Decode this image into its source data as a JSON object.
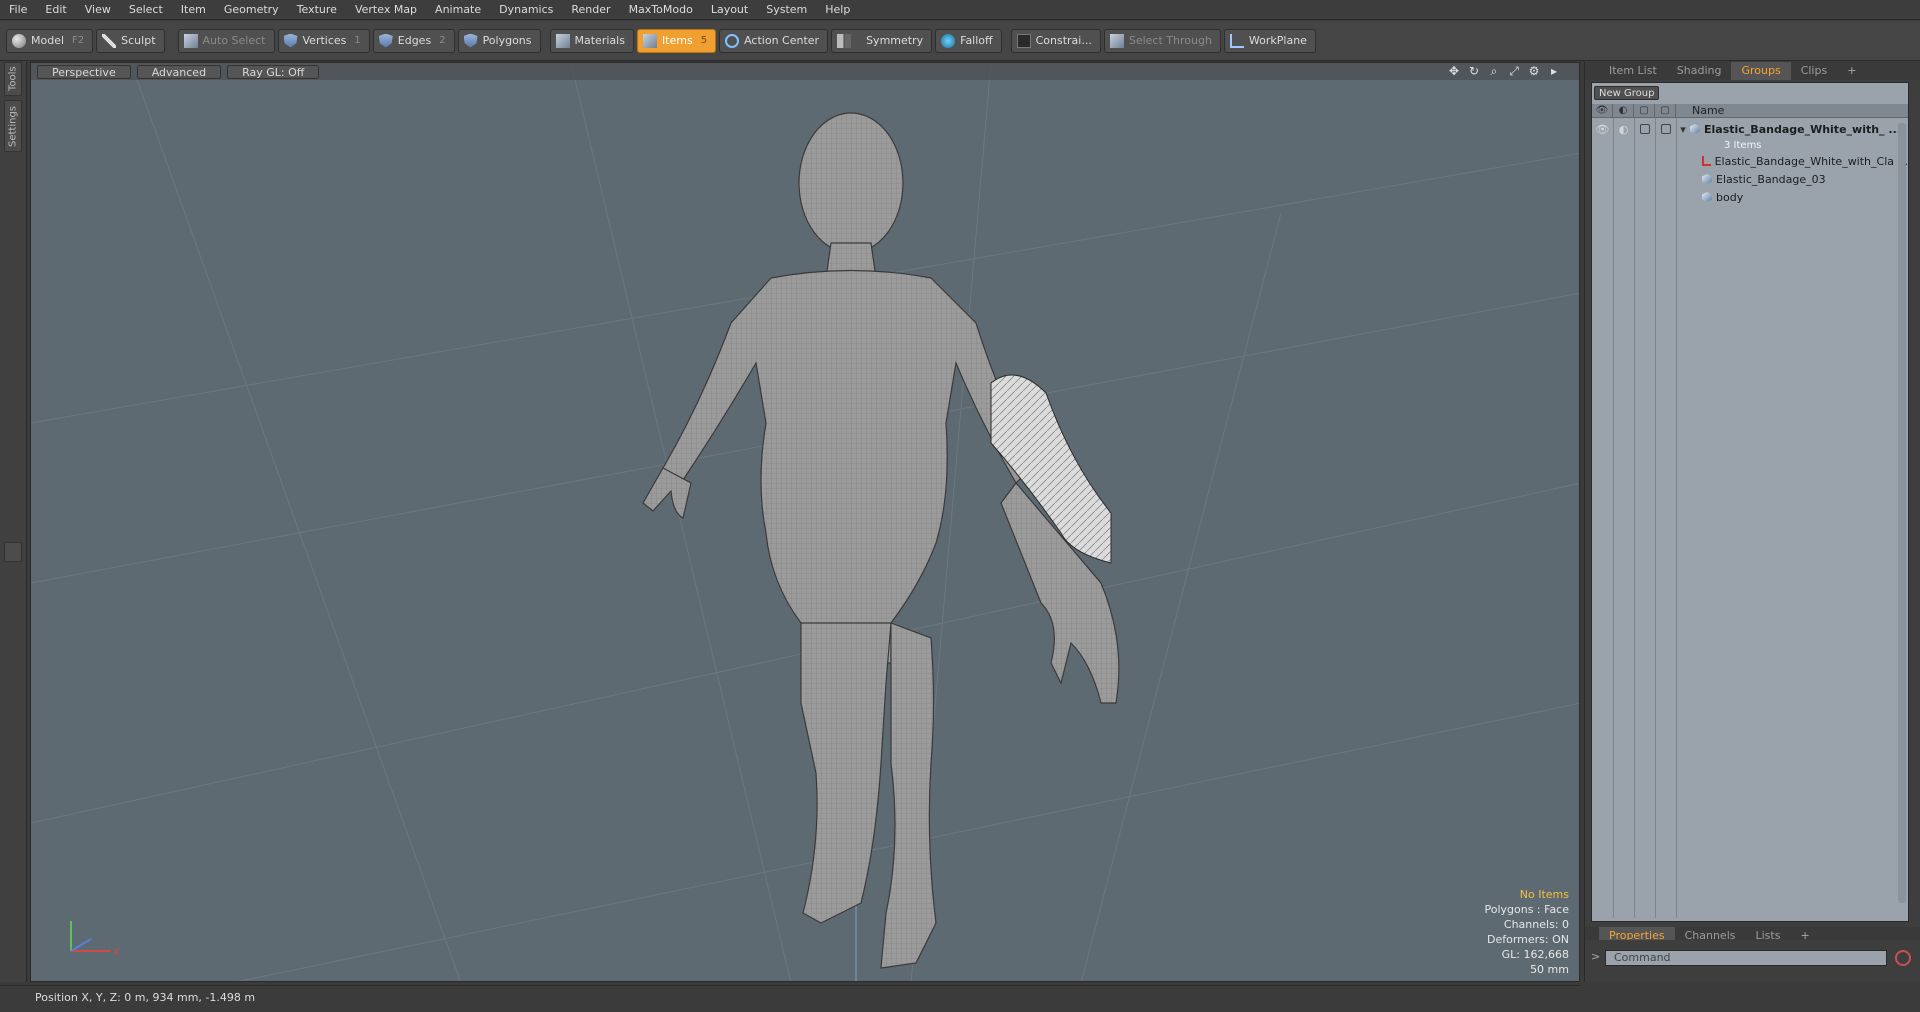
{
  "menu": [
    "File",
    "Edit",
    "View",
    "Select",
    "Item",
    "Geometry",
    "Texture",
    "Vertex Map",
    "Animate",
    "Dynamics",
    "Render",
    "MaxToModo",
    "Layout",
    "System",
    "Help"
  ],
  "toolbar": {
    "model": "Model",
    "model_key": "F2",
    "sculpt": "Sculpt",
    "auto_select": "Auto Select",
    "vertices": "Vertices",
    "vertices_key": "1",
    "edges": "Edges",
    "edges_key": "2",
    "polygons": "Polygons",
    "materials": "Materials",
    "items": "Items",
    "items_key": "5",
    "action_center": "Action Center",
    "symmetry": "Symmetry",
    "falloff": "Falloff",
    "constraints": "Constrai...",
    "select_through": "Select Through",
    "workplane": "WorkPlane"
  },
  "left_tabs": {
    "tools": "Tools",
    "settings": "Settings"
  },
  "viewport": {
    "perspective": "Perspective",
    "advanced": "Advanced",
    "raygl": "Ray GL: Off",
    "stats": {
      "no_items": "No Items",
      "polygons": "Polygons : Face",
      "channels": "Channels: 0",
      "deformers": "Deformers: ON",
      "gl": "GL: 162,668",
      "lens": "50 mm"
    }
  },
  "panel_tabs": [
    "Item List",
    "Shading",
    "Groups",
    "Clips"
  ],
  "active_panel_tab": "Groups",
  "groups": {
    "new_group": "New Group",
    "name_col": "Name",
    "root": "Elastic_Bandage_White_with_ ...",
    "root_count": "3 Items",
    "children": [
      "Elastic_Bandage_White_with_Cla ...",
      "Elastic_Bandage_03",
      "body"
    ]
  },
  "bottom_tabs": [
    "Properties",
    "Channels",
    "Lists"
  ],
  "command_placeholder": "Command",
  "status": "Position X, Y, Z:  0 m, 934 mm, -1.498 m",
  "colors": {
    "accent": "#f0a030",
    "viewport_bg": "#5e6a72"
  }
}
